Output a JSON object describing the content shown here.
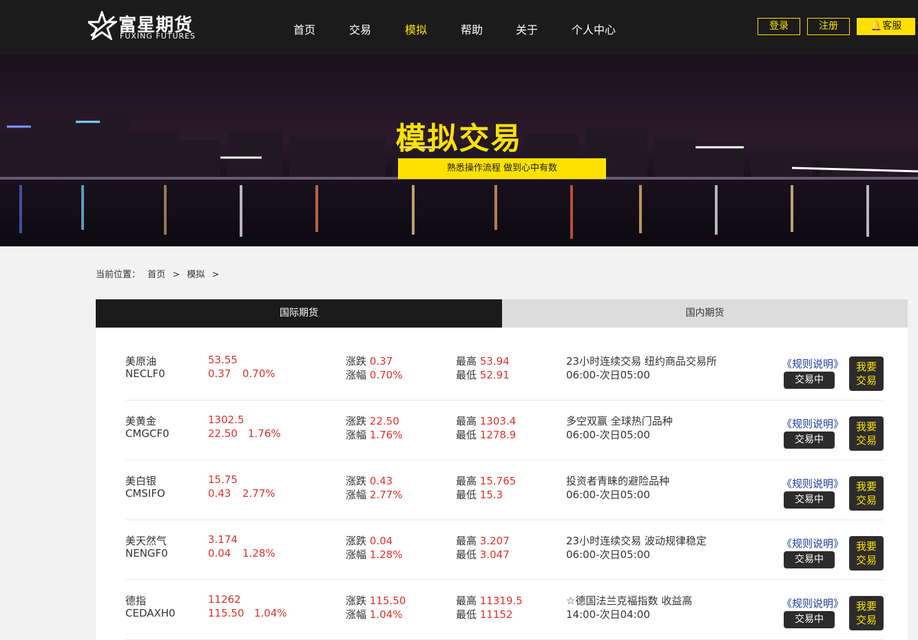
{
  "header": {
    "logo_cn": "富星期货",
    "logo_en": "FUXING FUTURES",
    "nav": [
      "首页",
      "交易",
      "模拟",
      "帮助",
      "关于",
      "个人中心"
    ],
    "active_nav": "模拟",
    "login": "登录",
    "register": "注册",
    "service": "客服"
  },
  "banner": {
    "title": "模拟交易",
    "subtitle": "熟悉操作流程 做到心中有数"
  },
  "breadcrumb": {
    "label": "当前位置：",
    "items": [
      "首页",
      ">",
      "模拟",
      ">"
    ]
  },
  "tabs": [
    "国际期货",
    "国内期货"
  ],
  "labels": {
    "change": "涨跌",
    "pct": "涨幅",
    "high": "最高",
    "low": "最低",
    "rule": "《规则说明》",
    "status": "交易中",
    "trade_line1": "我要",
    "trade_line2": "交易"
  },
  "rows": [
    {
      "name": "美原油",
      "code": "NECLF0",
      "price": "53.55",
      "chg": "0.37",
      "pct": "0.70%",
      "change": "0.37",
      "change_pct": "0.70%",
      "high": "53.94",
      "low": "52.91",
      "desc": "23小时连续交易 纽约商品交易所",
      "time": "06:00-次日05:00"
    },
    {
      "name": "美黄金",
      "code": "CMGCF0",
      "price": "1302.5",
      "chg": "22.50",
      "pct": "1.76%",
      "change": "22.50",
      "change_pct": "1.76%",
      "high": "1303.4",
      "low": "1278.9",
      "desc": "多空双赢 全球热门品种",
      "time": "06:00-次日05:00"
    },
    {
      "name": "美白银",
      "code": "CMSIFO",
      "price": "15.75",
      "chg": "0.43",
      "pct": "2.77%",
      "change": "0.43",
      "change_pct": "2.77%",
      "high": "15.765",
      "low": "15.3",
      "desc": "投资者青睐的避险品种",
      "time": "06:00-次日05:00"
    },
    {
      "name": "美天然气",
      "code": "NENGF0",
      "price": "3.174",
      "chg": "0.04",
      "pct": "1.28%",
      "change": "0.04",
      "change_pct": "1.28%",
      "high": "3.207",
      "low": "3.047",
      "desc": "23小时连续交易 波动规律稳定",
      "time": "06:00-次日05:00"
    },
    {
      "name": "德指",
      "code": "CEDAXH0",
      "price": "11262",
      "chg": "115.50",
      "pct": "1.04%",
      "change": "115.50",
      "change_pct": "1.04%",
      "high": "11319.5",
      "low": "11152",
      "desc": "☆德国法兰克福指数 收益高",
      "time": "14:00-次日04:00"
    }
  ],
  "colors": {
    "accent": "#ffe100",
    "header_bg": "#1b1b1b",
    "up": "#e0312a",
    "link": "#1b3a9e"
  }
}
